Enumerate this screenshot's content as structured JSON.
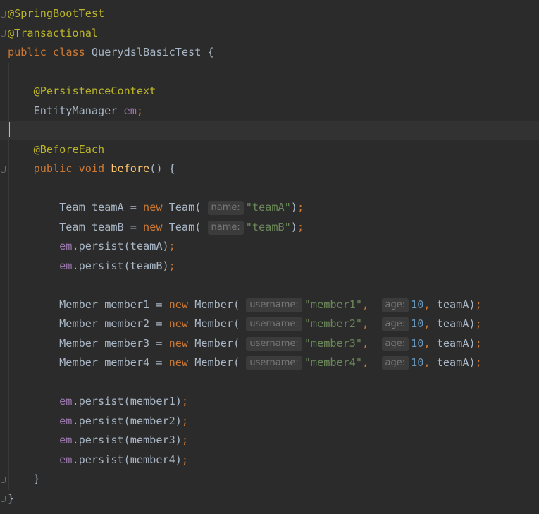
{
  "code": {
    "annotation_springboottest": "@SpringBootTest",
    "annotation_transactional": "@Transactional",
    "kw_public": "public",
    "kw_class": "class",
    "class_name": "QuerydslBasicTest",
    "brace_open": "{",
    "brace_close": "}",
    "annotation_persistencecontext": "@PersistenceContext",
    "type_entitymanager": "EntityManager",
    "field_em": "em",
    "semicolon": ";",
    "annotation_beforeeach": "@BeforeEach",
    "kw_void": "void",
    "method_before": "before",
    "parens": "()",
    "type_team": "Team",
    "type_member": "Member",
    "kw_new": "new",
    "var_teamA": "teamA",
    "var_teamB": "teamB",
    "var_member1": "member1",
    "var_member2": "member2",
    "var_member3": "member3",
    "var_member4": "member4",
    "persist_call": ".persist(",
    "hint_name": "name:",
    "hint_username": "username:",
    "hint_age": "age:",
    "str_teamA": "\"teamA\"",
    "str_teamB": "\"teamB\"",
    "str_member1": "\"member1\"",
    "str_member2": "\"member2\"",
    "str_member3": "\"member3\"",
    "str_member4": "\"member4\"",
    "num_age": "10",
    "close_paren_semi": ");"
  }
}
